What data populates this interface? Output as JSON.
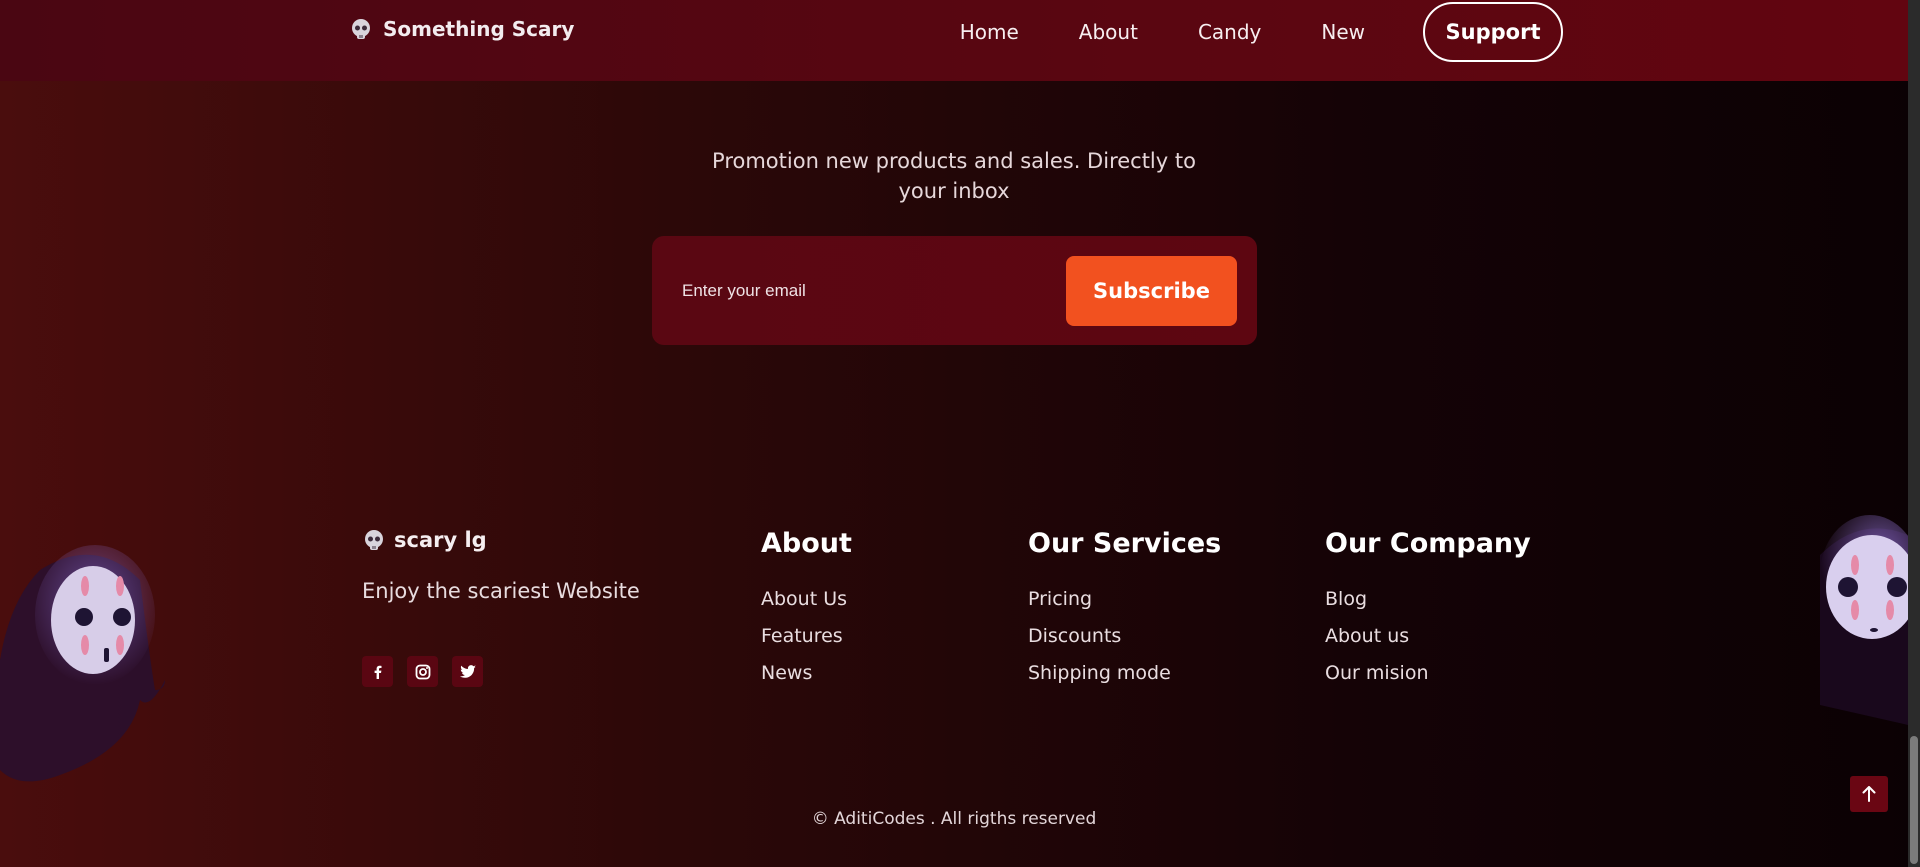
{
  "nav": {
    "brand": "Something Scary",
    "links": [
      "Home",
      "About",
      "Candy",
      "New"
    ],
    "support_label": "Support"
  },
  "newsletter": {
    "promo_text": "Promotion new products and sales. Directly to your inbox",
    "email_placeholder": "Enter your email",
    "subscribe_label": "Subscribe"
  },
  "footer": {
    "brand": "scary lg",
    "tagline": "Enjoy the scariest Website",
    "socials": [
      "facebook-icon",
      "instagram-icon",
      "twitter-icon"
    ],
    "columns": [
      {
        "title": "About",
        "links": [
          "About Us",
          "Features",
          "News"
        ]
      },
      {
        "title": "Our Services",
        "links": [
          "Pricing",
          "Discounts",
          "Shipping mode"
        ]
      },
      {
        "title": "Our Company",
        "links": [
          "Blog",
          "About us",
          "Our mision"
        ]
      }
    ],
    "copyright": "© AditiCodes . All rigths reserved"
  },
  "colors": {
    "accent": "#f2511f",
    "nav_bg": "#5a0611",
    "box_bg": "#5a0712"
  }
}
